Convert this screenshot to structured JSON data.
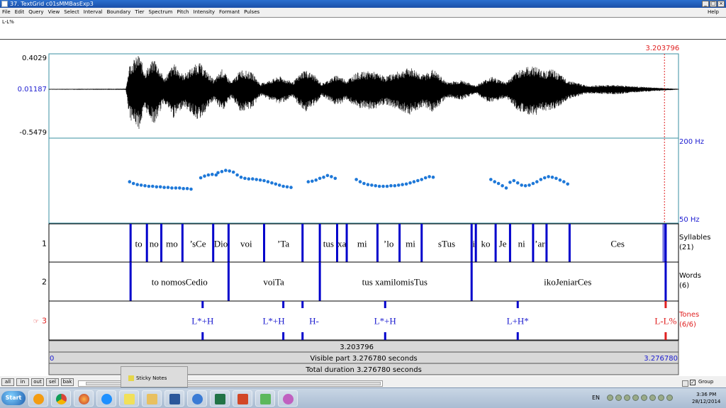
{
  "window": {
    "title": "37. TextGrid c01sMMBasExp3"
  },
  "menu": {
    "items": [
      "File",
      "Edit",
      "Query",
      "View",
      "Select",
      "Interval",
      "Boundary",
      "Tier",
      "Spectrum",
      "Pitch",
      "Intensity",
      "Formant",
      "Pulses"
    ],
    "help": "Help"
  },
  "text_field": {
    "value": "L-L%"
  },
  "waveform": {
    "max_label": "0.4029",
    "zero_label": "0.01187",
    "min_label": "-0.5479",
    "cursor_time_label": "3.203796",
    "cursor_time": 3.203796
  },
  "pitch": {
    "top_label": "200 Hz",
    "bottom_label": "50 Hz",
    "dot_color": "#1e78d8",
    "points": [
      [
        0.42,
        123
      ],
      [
        0.44,
        120
      ],
      [
        0.46,
        118
      ],
      [
        0.48,
        117
      ],
      [
        0.5,
        116
      ],
      [
        0.52,
        115
      ],
      [
        0.54,
        115
      ],
      [
        0.56,
        114
      ],
      [
        0.58,
        114
      ],
      [
        0.6,
        113
      ],
      [
        0.62,
        113
      ],
      [
        0.64,
        112
      ],
      [
        0.66,
        112
      ],
      [
        0.68,
        112
      ],
      [
        0.7,
        111
      ],
      [
        0.72,
        111
      ],
      [
        0.74,
        110
      ],
      [
        0.79,
        130
      ],
      [
        0.81,
        133
      ],
      [
        0.83,
        135
      ],
      [
        0.85,
        136
      ],
      [
        0.87,
        135
      ],
      [
        0.88,
        139
      ],
      [
        0.9,
        141
      ],
      [
        0.92,
        143
      ],
      [
        0.94,
        142
      ],
      [
        0.96,
        140
      ],
      [
        0.98,
        135
      ],
      [
        1.0,
        131
      ],
      [
        1.02,
        129
      ],
      [
        1.04,
        128
      ],
      [
        1.06,
        128
      ],
      [
        1.08,
        127
      ],
      [
        1.1,
        126
      ],
      [
        1.12,
        125
      ],
      [
        1.14,
        123
      ],
      [
        1.16,
        121
      ],
      [
        1.18,
        119
      ],
      [
        1.2,
        117
      ],
      [
        1.22,
        115
      ],
      [
        1.24,
        114
      ],
      [
        1.26,
        113
      ],
      [
        1.35,
        123
      ],
      [
        1.37,
        124
      ],
      [
        1.39,
        126
      ],
      [
        1.41,
        129
      ],
      [
        1.43,
        131
      ],
      [
        1.45,
        134
      ],
      [
        1.47,
        132
      ],
      [
        1.49,
        129
      ],
      [
        1.6,
        127
      ],
      [
        1.62,
        123
      ],
      [
        1.64,
        120
      ],
      [
        1.66,
        118
      ],
      [
        1.68,
        117
      ],
      [
        1.7,
        116
      ],
      [
        1.72,
        115
      ],
      [
        1.74,
        115
      ],
      [
        1.76,
        115
      ],
      [
        1.78,
        116
      ],
      [
        1.8,
        116
      ],
      [
        1.82,
        117
      ],
      [
        1.84,
        118
      ],
      [
        1.86,
        119
      ],
      [
        1.88,
        121
      ],
      [
        1.9,
        123
      ],
      [
        1.92,
        125
      ],
      [
        1.94,
        127
      ],
      [
        1.96,
        130
      ],
      [
        1.98,
        132
      ],
      [
        2.0,
        131
      ],
      [
        2.3,
        127
      ],
      [
        2.32,
        123
      ],
      [
        2.34,
        120
      ],
      [
        2.36,
        116
      ],
      [
        2.38,
        112
      ],
      [
        2.4,
        122
      ],
      [
        2.42,
        125
      ],
      [
        2.44,
        121
      ],
      [
        2.46,
        117
      ],
      [
        2.48,
        116
      ],
      [
        2.5,
        117
      ],
      [
        2.52,
        120
      ],
      [
        2.54,
        123
      ],
      [
        2.56,
        127
      ],
      [
        2.58,
        130
      ],
      [
        2.6,
        132
      ],
      [
        2.62,
        131
      ],
      [
        2.64,
        129
      ],
      [
        2.66,
        126
      ],
      [
        2.68,
        123
      ],
      [
        2.7,
        119
      ]
    ]
  },
  "tiers": [
    {
      "number": "1",
      "name": "Syllables",
      "count": "(21)",
      "boundaries": [
        0.425,
        0.51,
        0.585,
        0.695,
        0.855,
        0.935,
        1.12,
        1.32,
        1.41,
        1.5,
        1.55,
        1.71,
        1.825,
        1.94,
        2.2,
        2.222,
        2.325,
        2.4,
        2.52,
        2.59,
        2.71,
        3.21
      ],
      "labels": [
        "to",
        "no",
        "mo",
        "’sCe",
        "Dio",
        "voi",
        "’Ta",
        "tus",
        "xa",
        "mi",
        "’lo",
        "mi",
        "sTus",
        "i",
        "ko",
        "Je",
        "ni",
        "’ar",
        "Ces"
      ],
      "label_centers": [
        0.467,
        0.547,
        0.64,
        0.775,
        0.895,
        1.027,
        1.22,
        1.455,
        1.525,
        1.63,
        1.768,
        1.882,
        2.07,
        2.211,
        2.273,
        2.362,
        2.46,
        2.555,
        2.96
      ]
    },
    {
      "number": "2",
      "name": "Words",
      "count": "(6)",
      "boundaries": [
        0.425,
        0.935,
        1.41,
        2.2,
        3.21
      ],
      "labels": [
        "to nomosCedio",
        "voiTa",
        "tus xamilomisTus",
        "ikoJeniarCes"
      ],
      "label_centers": [
        0.68,
        1.17,
        1.8,
        2.7
      ]
    },
    {
      "number": "3",
      "name": "Tones",
      "count": "(6/6)",
      "selected": true,
      "points": [
        0.8,
        1.22,
        1.32,
        1.75,
        2.44,
        3.21
      ],
      "labels": [
        "L*+H",
        "L*+H",
        "H-",
        "L*+H",
        "L+H*",
        "L-L%"
      ],
      "label_offsets": [
        0,
        -0.05,
        0.06,
        0,
        0,
        0
      ]
    }
  ],
  "time_axis": {
    "cursor_label": "3.203796",
    "visible_start": "0",
    "visible_end": "3.276780",
    "visible_text": "Visible part 3.276780 seconds",
    "total_text": "Total duration 3.276780 seconds",
    "duration": 3.27678
  },
  "zoom_buttons": [
    "all",
    "in",
    "out",
    "sel",
    "bak"
  ],
  "group_label": "Group",
  "sticky_notes": "Sticky Notes",
  "taskbar": {
    "start": "Start",
    "language": "EN",
    "time": "3:36 PM",
    "date": "28/12/2014"
  },
  "colors": {
    "tier_line": "#0000cc",
    "tone_text": "#2020d0",
    "selected_red": "#e02020",
    "axis_label_blue": "#1a1ad0"
  }
}
